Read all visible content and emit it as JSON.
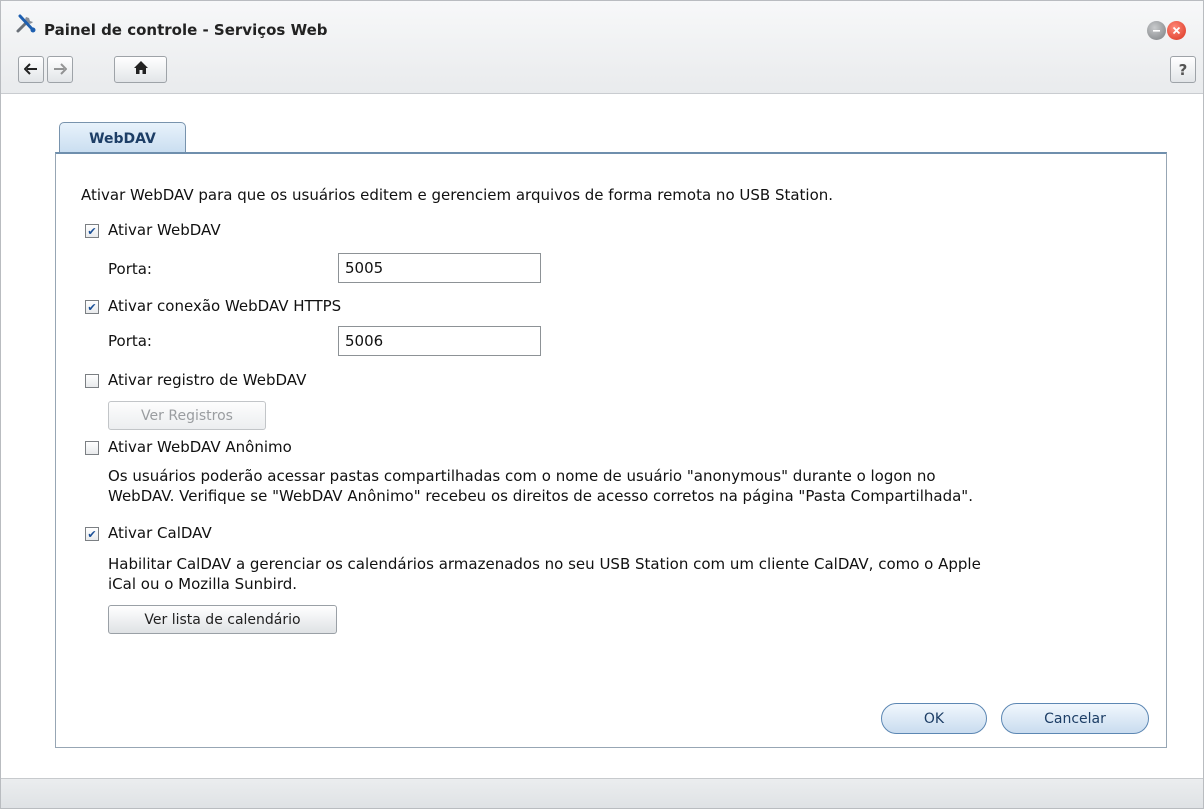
{
  "window": {
    "title": "Painel de controle - Serviços Web",
    "help_label": "?"
  },
  "tab": {
    "label": "WebDAV"
  },
  "content": {
    "intro": "Ativar WebDAV para que os usuários editem e gerenciem arquivos de forma remota no USB Station.",
    "webdav": {
      "label": "Ativar WebDAV",
      "checked": true,
      "port_label": "Porta:",
      "port_value": "5005"
    },
    "https": {
      "label": "Ativar conexão WebDAV HTTPS",
      "checked": true,
      "port_label": "Porta:",
      "port_value": "5006"
    },
    "log": {
      "label": "Ativar registro de WebDAV",
      "checked": false,
      "button": "Ver Registros"
    },
    "anonymous": {
      "label": "Ativar WebDAV Anônimo",
      "checked": false,
      "desc_line1": "Os usuários poderão acessar pastas compartilhadas com o nome de usuário \"anonymous\" durante o logon no",
      "desc_line2": "WebDAV. Verifique se \"WebDAV Anônimo\" recebeu os direitos de acesso corretos na página \"Pasta Compartilhada\"."
    },
    "caldav": {
      "label": "Ativar CalDAV",
      "checked": true,
      "desc_line1": "Habilitar CalDAV a gerenciar os calendários armazenados no seu USB Station com um cliente CalDAV, como o Apple",
      "desc_line2": "iCal ou o Mozilla Sunbird.",
      "button": "Ver lista de calendário"
    }
  },
  "actions": {
    "ok": "OK",
    "cancel": "Cancelar"
  },
  "icons": {
    "app": "tools-icon",
    "back": "arrow-left-icon",
    "forward": "arrow-right-icon",
    "home": "home-icon",
    "minimize": "minimize-icon",
    "close": "close-icon"
  }
}
